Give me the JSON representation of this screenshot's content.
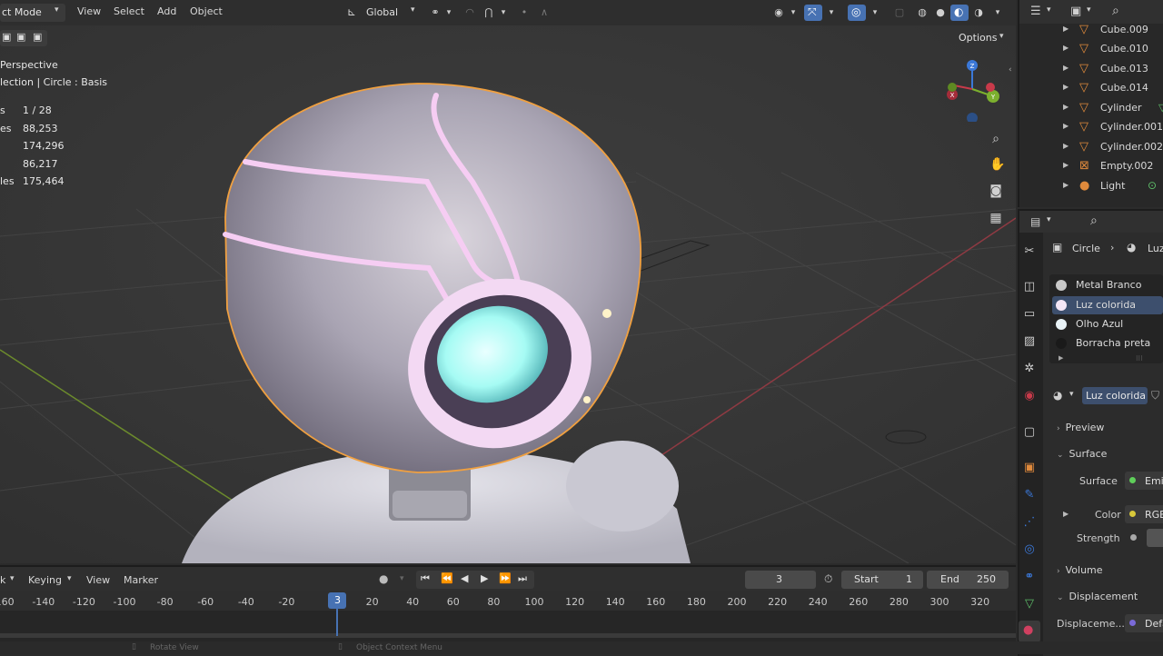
{
  "header": {
    "mode_label": "ct Mode",
    "menus": [
      "View",
      "Select",
      "Add",
      "Object"
    ],
    "transform_orientation": "Global",
    "options_label": "Options"
  },
  "viewport": {
    "view_name": "Perspective",
    "collection_info": "lection | Circle : Basis",
    "stats": [
      {
        "label": "s",
        "value": "1 / 28"
      },
      {
        "label": "es",
        "value": "88,253"
      },
      {
        "label": "",
        "value": "174,296"
      },
      {
        "label": "",
        "value": "86,217"
      },
      {
        "label": "les",
        "value": "175,464"
      }
    ],
    "gizmo_axes": {
      "x": "X",
      "y": "Y",
      "z": "Z"
    }
  },
  "outliner": {
    "items": [
      {
        "label": "Cube.009",
        "icon": "triangle-mesh-icon"
      },
      {
        "label": "Cube.010",
        "icon": "triangle-mesh-icon"
      },
      {
        "label": "Cube.013",
        "icon": "triangle-mesh-icon"
      },
      {
        "label": "Cube.014",
        "icon": "triangle-mesh-icon"
      },
      {
        "label": "Cylinder",
        "icon": "triangle-mesh-icon"
      },
      {
        "label": "Cylinder.001",
        "icon": "triangle-mesh-icon"
      },
      {
        "label": "Cylinder.002",
        "icon": "triangle-mesh-icon"
      },
      {
        "label": "Empty.002",
        "icon": "empty-icon"
      },
      {
        "label": "Light",
        "icon": "light-icon"
      }
    ]
  },
  "properties": {
    "breadcrumb_object": "Circle",
    "breadcrumb_material": "Luz",
    "material_slots": [
      {
        "label": "Metal Branco",
        "color": "#c8c8c8"
      },
      {
        "label": "Luz colorida",
        "color": "#f4e6f6"
      },
      {
        "label": "Olho Azul",
        "color": "#e9f3f7"
      },
      {
        "label": "Borracha preta",
        "color": "#1a1a1a"
      }
    ],
    "active_material": "Luz colorida",
    "sections": {
      "preview": "Preview",
      "surface": "Surface",
      "volume": "Volume",
      "displacement": "Displacement"
    },
    "fields": {
      "surface_label": "Surface",
      "surface_value": "Emi",
      "color_label": "Color",
      "color_value": "RGB",
      "strength_label": "Strength",
      "displacement_label": "Displaceme...",
      "displacement_value": "Defa"
    }
  },
  "timeline": {
    "menus": [
      "k",
      "Keying",
      "View",
      "Marker"
    ],
    "current_frame": "3",
    "start_label": "Start",
    "start_value": "1",
    "end_label": "End",
    "end_value": "250",
    "ruler": [
      "-160",
      "-140",
      "-120",
      "-100",
      "-80",
      "-60",
      "-40",
      "-20",
      "20",
      "40",
      "60",
      "80",
      "100",
      "120",
      "140",
      "160",
      "180",
      "200",
      "220",
      "240",
      "260",
      "280",
      "300",
      "320"
    ],
    "playhead_label": "3"
  },
  "statusbar": {
    "left": "Rotate View",
    "mid": "Object Context Menu"
  },
  "colors": {
    "accent": "#4772b3",
    "outline": "#f0a040",
    "x_axis": "#c83a4a",
    "y_axis": "#7cb02e",
    "z_axis": "#3b78d8"
  }
}
